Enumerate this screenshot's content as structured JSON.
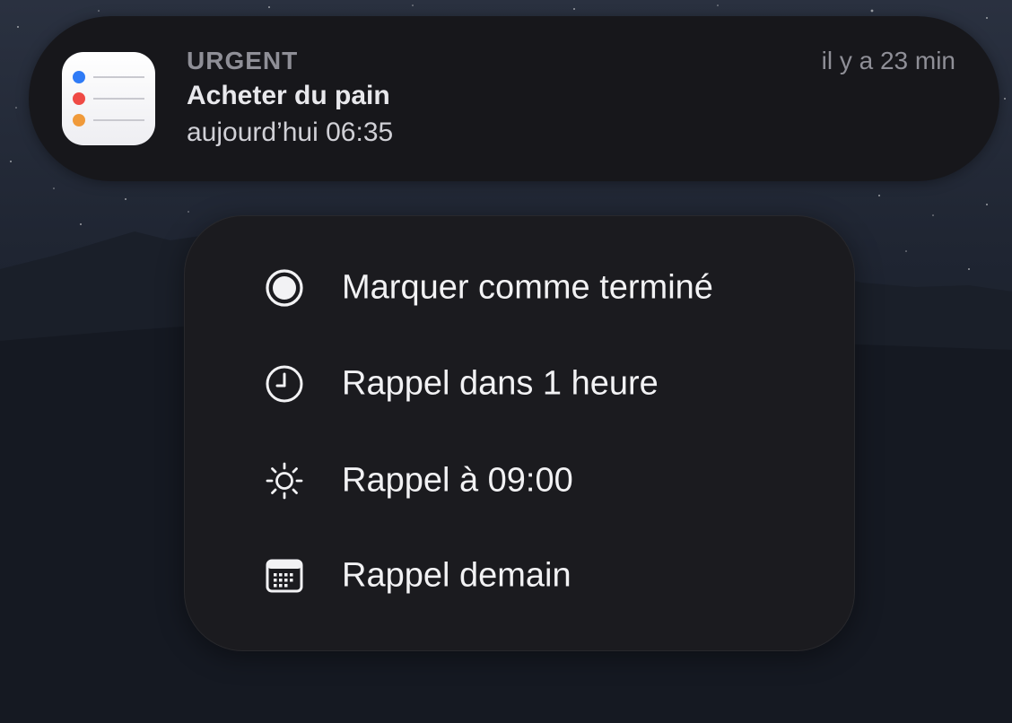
{
  "notification": {
    "app_icon": "reminders-app-icon",
    "category": "URGENT",
    "time_ago": "il y a 23 min",
    "title": "Acheter du pain",
    "subtitle": "aujourd’hui 06:35"
  },
  "actions": [
    {
      "label": "Marquer comme terminé",
      "icon": "completed-circle-icon"
    },
    {
      "label": "Rappel dans 1 heure",
      "icon": "clock-icon"
    },
    {
      "label": "Rappel à 09:00",
      "icon": "sun-icon"
    },
    {
      "label": "Rappel demain",
      "icon": "calendar-icon"
    }
  ],
  "colors": {
    "background": "#10141c",
    "panel": "#17171b",
    "menu": "#1b1b1f",
    "text_primary": "#f2f2f4",
    "text_secondary": "#8f8f97",
    "icon_dot_blue": "#2f7bf6",
    "icon_dot_red": "#ef4a45",
    "icon_dot_orange": "#f09a3a"
  }
}
